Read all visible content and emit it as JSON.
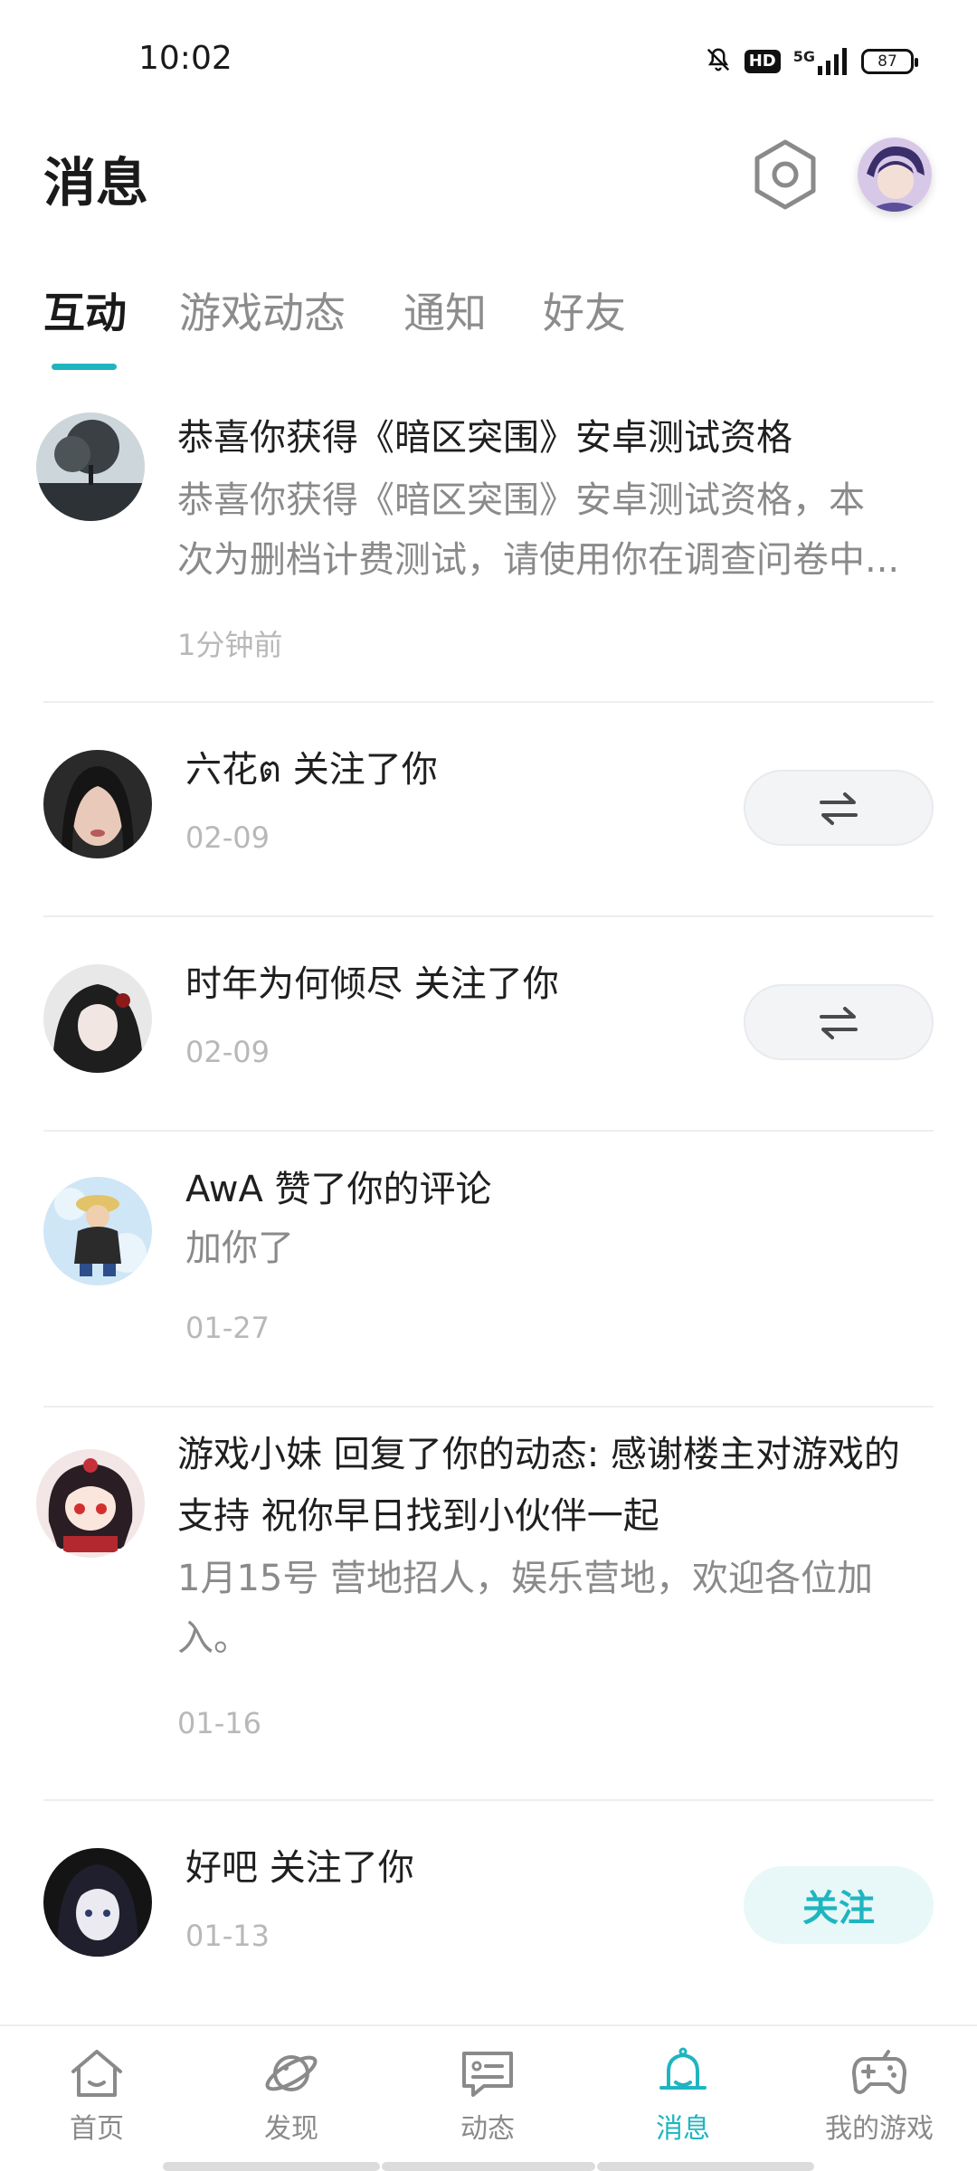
{
  "status_bar": {
    "time": "10:02",
    "network": "5G",
    "hd": "HD",
    "battery": "87",
    "icons": [
      "mute-bell-icon",
      "hd-icon",
      "5g-signal-icon",
      "battery-icon"
    ]
  },
  "header": {
    "title": "消息",
    "settings_icon": "settings-hex-icon",
    "avatar_icon": "user-avatar"
  },
  "tabs": [
    {
      "label": "互动",
      "active": true
    },
    {
      "label": "游戏动态",
      "active": false
    },
    {
      "label": "通知",
      "active": false
    },
    {
      "label": "好友",
      "active": false
    }
  ],
  "messages": [
    {
      "title": "恭喜你获得《暗区突围》安卓测试资格",
      "body_line1": "恭喜你获得《暗区突围》安卓测试资格，本",
      "body_line2": "次为删档计费测试，请使用你在调查问卷中...",
      "time": "1分钟前"
    },
    {
      "title": "六花ต 关注了你",
      "time": "02-09",
      "action": "mutual-follow-icon"
    },
    {
      "title": "时年为何倾尽 关注了你",
      "time": "02-09",
      "action": "mutual-follow-icon"
    },
    {
      "title": "AwA 赞了你的评论",
      "body_line1": "加你了",
      "time": "01-27"
    },
    {
      "title_line1": "游戏小妹 回复了你的动态: 感谢楼主对游戏的",
      "title_line2": "支持 祝你早日找到小伙伴一起",
      "body_line1": "1月15号 营地招人，娱乐营地，欢迎各位加",
      "body_line2": "入。",
      "time": "01-16"
    },
    {
      "title": "好吧 关注了你",
      "time": "01-13",
      "action_label": "关注"
    }
  ],
  "bottom_nav": [
    {
      "label": "首页",
      "icon": "home-icon",
      "active": false
    },
    {
      "label": "发现",
      "icon": "planet-icon",
      "active": false
    },
    {
      "label": "动态",
      "icon": "feed-chat-icon",
      "active": false
    },
    {
      "label": "消息",
      "icon": "bell-icon",
      "active": true
    },
    {
      "label": "我的游戏",
      "icon": "gamepad-icon",
      "active": false
    }
  ],
  "colors": {
    "accent": "#1fb5c0",
    "text_primary": "#1f1f1f",
    "text_secondary": "#8a8a8a",
    "text_time": "#b8b8b8"
  }
}
